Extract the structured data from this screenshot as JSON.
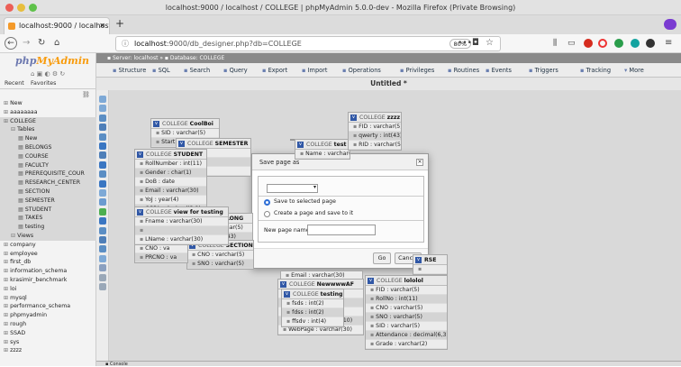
{
  "window": {
    "title": "localhost:9000 / localhost / COLLEGE | phpMyAdmin 5.0.0-dev - Mozilla Firefox (Private Browsing)"
  },
  "browser": {
    "tab_title": "localhost:9000 / localhost",
    "url_host": "localhost",
    "url_rest": ":9000/db_designer.php?db=COLLEGE",
    "zoom": "80%",
    "new_tab": "+"
  },
  "sidebar": {
    "logo": "phpMyAdmin",
    "recent": "Recent",
    "favorites": "Favorites",
    "tree": [
      {
        "label": "New",
        "indent": 1,
        "sel": false
      },
      {
        "label": "aaaaaaaa",
        "indent": 1,
        "sel": false
      },
      {
        "label": "COLLEGE",
        "indent": 1,
        "sel": true
      },
      {
        "label": "Tables",
        "indent": 2,
        "sel": true
      },
      {
        "label": "New",
        "indent": 3,
        "sel": true
      },
      {
        "label": "BELONGS",
        "indent": 3,
        "sel": true
      },
      {
        "label": "COURSE",
        "indent": 3,
        "sel": true
      },
      {
        "label": "FACULTY",
        "indent": 3,
        "sel": true
      },
      {
        "label": "PREREQUISITE_COUR",
        "indent": 3,
        "sel": true
      },
      {
        "label": "RESEARCH_CENTER",
        "indent": 3,
        "sel": true
      },
      {
        "label": "SECTION",
        "indent": 3,
        "sel": true
      },
      {
        "label": "SEMESTER",
        "indent": 3,
        "sel": true
      },
      {
        "label": "STUDENT",
        "indent": 3,
        "sel": true
      },
      {
        "label": "TAKES",
        "indent": 3,
        "sel": true
      },
      {
        "label": "testing",
        "indent": 3,
        "sel": true
      },
      {
        "label": "Views",
        "indent": 2,
        "sel": true
      },
      {
        "label": "company",
        "indent": 1,
        "sel": false
      },
      {
        "label": "employee",
        "indent": 1,
        "sel": false
      },
      {
        "label": "first_db",
        "indent": 1,
        "sel": false
      },
      {
        "label": "information_schema",
        "indent": 1,
        "sel": false
      },
      {
        "label": "krasimir_benchmark",
        "indent": 1,
        "sel": false
      },
      {
        "label": "loi",
        "indent": 1,
        "sel": false
      },
      {
        "label": "mysql",
        "indent": 1,
        "sel": false
      },
      {
        "label": "performance_schema",
        "indent": 1,
        "sel": false
      },
      {
        "label": "phpmyadmin",
        "indent": 1,
        "sel": false
      },
      {
        "label": "rough",
        "indent": 1,
        "sel": false
      },
      {
        "label": "SSAD",
        "indent": 1,
        "sel": false
      },
      {
        "label": "sys",
        "indent": 1,
        "sel": false
      },
      {
        "label": "zzzz",
        "indent": 1,
        "sel": false
      }
    ]
  },
  "main": {
    "breadcrumb_server": "Server: localhost",
    "breadcrumb_db": "Database: COLLEGE",
    "tabs": [
      "Structure",
      "SQL",
      "Search",
      "Query",
      "Export",
      "Import",
      "Operations",
      "Privileges",
      "Routines",
      "Events",
      "Triggers",
      "Tracking",
      "More"
    ],
    "designer_title": "Untitled *",
    "console": "Console"
  },
  "designer_tables": [
    {
      "db": "COLLEGE",
      "name": "CoolBoi",
      "rows": [
        "SID : varchar(5)",
        "Start"
      ]
    },
    {
      "db": "COLLEGE",
      "name": "SEMESTER",
      "rows": [
        "char(5)",
        "date",
        "date"
      ]
    },
    {
      "db": "COLLEGE",
      "name": "test",
      "rows": [
        "Name : varchar(30)"
      ]
    },
    {
      "db": "COLLEGE",
      "name": "zzzz",
      "rows": [
        "FID : varchar(5)",
        "qwerty : int(43)",
        "RID : varchar(5)"
      ]
    },
    {
      "db": "COLLEGE",
      "name": "STUDENT",
      "rows": [
        "RollNumber : int(11)",
        "Gender : char(1)",
        "DoB : date",
        "Email : varchar(30)",
        "YoJ : year(4)",
        "CGPA : decimal(3,2)"
      ]
    },
    {
      "db": "COLLEGE",
      "name": "view for testing",
      "rows": [
        "Fname : varchar(30)",
        "",
        "LName : varchar(30)"
      ]
    },
    {
      "db": "",
      "name": "BELONG",
      "rows": [
        "archar(5)",
        "int(43)"
      ]
    },
    {
      "db": "COLLEGE",
      "name": "SECTION",
      "rows": [
        "CNO : varchar(5)",
        "SNO : varchar(5)"
      ]
    },
    {
      "db": "",
      "name": "",
      "rows": [
        "CNO : va",
        "PRCNO : va"
      ]
    },
    {
      "db": "",
      "name": "",
      "rows": [
        "Email : varchar(30)"
      ]
    },
    {
      "db": "COLLEGE",
      "name": "NewwwwAF",
      "rows": [
        "",
        "",
        "",
        "MobileNo : varchar(10)",
        "WebPage : varchar(30)"
      ]
    },
    {
      "db": "COLLEGE",
      "name": "testing",
      "rows": [
        "fsds : int(2)",
        "fdss : int(2)",
        "ffsdv : int(4)"
      ]
    },
    {
      "db": "COLLEGE",
      "name": "lololol",
      "rows": [
        "FID : varchar(5)",
        "RollNo : int(11)",
        "CNO : varchar(5)",
        "SNO : varchar(5)",
        "SID : varchar(5)",
        "Attendance : decimal(6,3)",
        "Grade : varchar(2)"
      ]
    },
    {
      "db": "",
      "name": "RSE",
      "rows": [
        ""
      ]
    }
  ],
  "modal": {
    "title": "Save page as",
    "close": "×",
    "select_value": "",
    "radio_selected": "Save to selected page",
    "radio_new": "Create a page and save to it",
    "new_page_label": "New page name",
    "new_page_value": "",
    "go": "Go",
    "cancel": "Cancel"
  }
}
